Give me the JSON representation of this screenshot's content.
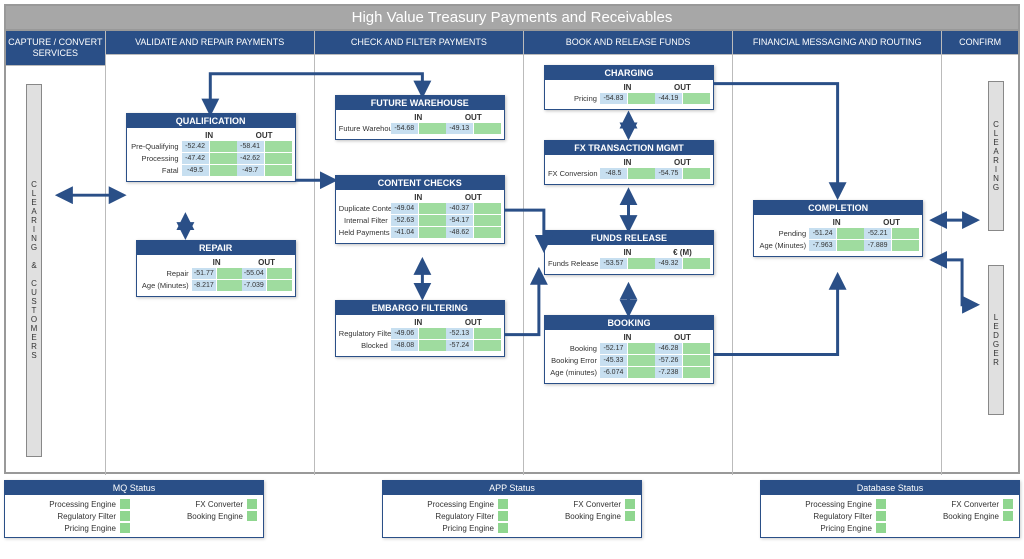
{
  "title": "High Value Treasury Payments and Receivables",
  "lanes": {
    "capture": "CAPTURE / CONVERT SERVICES",
    "validate": "VALIDATE AND REPAIR PAYMENTS",
    "check": "CHECK AND FILTER PAYMENTS",
    "book": "BOOK AND RELEASE FUNDS",
    "messaging": "FINANCIAL MESSAGING AND ROUTING",
    "confirm": "CONFIRM"
  },
  "side": {
    "clearing_customers": "CLEARING & CUSTOMERS",
    "clearing": "CLEARING",
    "ledger": "LEDGER"
  },
  "inout": {
    "in": "IN",
    "out": "OUT"
  },
  "cards": {
    "qualification": {
      "title": "QUALIFICATION",
      "rows": [
        {
          "label": "Pre-Qualifying",
          "in_b": "-52.42",
          "in_g": "",
          "out_b": "-58.41",
          "out_g": ""
        },
        {
          "label": "Processing",
          "in_b": "-47.42",
          "in_g": "",
          "out_b": "-42.62",
          "out_g": ""
        },
        {
          "label": "Fatal",
          "in_b": "-49.5",
          "in_g": "",
          "out_b": "-49.7",
          "out_g": ""
        }
      ]
    },
    "repair": {
      "title": "REPAIR",
      "rows": [
        {
          "label": "Repair",
          "in_b": "-51.77",
          "in_g": "",
          "out_b": "-55.04",
          "out_g": ""
        },
        {
          "label": "Age (Minutes)",
          "in_b": "-8.217",
          "in_g": "",
          "out_b": "-7.039",
          "out_g": ""
        }
      ]
    },
    "future_warehouse": {
      "title": "FUTURE WAREHOUSE",
      "rows": [
        {
          "label": "Future Warehouse",
          "in_b": "-54.68",
          "in_g": "",
          "out_b": "-49.13",
          "out_g": ""
        }
      ]
    },
    "content_checks": {
      "title": "CONTENT CHECKS",
      "rows": [
        {
          "label": "Duplicate Content",
          "in_b": "-49.04",
          "in_g": "",
          "out_b": "-40.37",
          "out_g": ""
        },
        {
          "label": "Internal Filter",
          "in_b": "-52.63",
          "in_g": "",
          "out_b": "-54.17",
          "out_g": ""
        },
        {
          "label": "Held Payments",
          "in_b": "-41.04",
          "in_g": "",
          "out_b": "-48.62",
          "out_g": ""
        }
      ]
    },
    "embargo": {
      "title": "EMBARGO FILTERING",
      "rows": [
        {
          "label": "Regulatory Filter",
          "in_b": "-49.06",
          "in_g": "",
          "out_b": "-52.13",
          "out_g": ""
        },
        {
          "label": "Blocked",
          "in_b": "-48.08",
          "in_g": "",
          "out_b": "-57.24",
          "out_g": ""
        }
      ]
    },
    "charging": {
      "title": "CHARGING",
      "rows": [
        {
          "label": "Pricing",
          "in_b": "-54.83",
          "in_g": "",
          "out_b": "-44.19",
          "out_g": ""
        }
      ]
    },
    "fx": {
      "title": "FX TRANSACTION MGMT",
      "rows": [
        {
          "label": "FX Conversion",
          "in_b": "-48.5",
          "in_g": "",
          "out_b": "-54.75",
          "out_g": ""
        }
      ]
    },
    "funds_release": {
      "title": "FUNDS RELEASE",
      "out_label": "€ (M)",
      "rows": [
        {
          "label": "Funds Release",
          "in_b": "-53.57",
          "in_g": "",
          "out_b": "-49.32",
          "out_g": ""
        }
      ]
    },
    "booking": {
      "title": "BOOKING",
      "rows": [
        {
          "label": "Booking",
          "in_b": "-52.17",
          "in_g": "",
          "out_b": "-46.28",
          "out_g": ""
        },
        {
          "label": "Booking Error",
          "in_b": "-45.33",
          "in_g": "",
          "out_b": "-57.26",
          "out_g": ""
        },
        {
          "label": "Age (minutes)",
          "in_b": "-6.074",
          "in_g": "",
          "out_b": "-7.238",
          "out_g": ""
        }
      ]
    },
    "completion": {
      "title": "COMPLETION",
      "rows": [
        {
          "label": "Pending",
          "in_b": "-51.24",
          "in_g": "",
          "out_b": "-52.21",
          "out_g": ""
        },
        {
          "label": "Age (Minutes)",
          "in_b": "-7.963",
          "in_g": "",
          "out_b": "-7.889",
          "out_g": ""
        }
      ]
    }
  },
  "status": {
    "mq": {
      "title": "MQ Status",
      "items": [
        "Processing Engine",
        "FX Converter",
        "Regulatory Filter",
        "Booking Engine",
        "Pricing Engine"
      ]
    },
    "app": {
      "title": "APP Status",
      "items": [
        "Processing Engine",
        "FX Converter",
        "Regulatory Filter",
        "Booking Engine",
        "Pricing Engine"
      ]
    },
    "db": {
      "title": "Database Status",
      "items": [
        "Processing Engine",
        "FX Converter",
        "Regulatory Filter",
        "Booking Engine",
        "Pricing Engine"
      ]
    }
  },
  "chart_data": {
    "type": "table",
    "title": "High Value Treasury Payments and Receivables — IN/OUT metrics",
    "series": [
      {
        "name": "Qualification/Pre-Qualifying",
        "in": -52.42,
        "out": -58.41
      },
      {
        "name": "Qualification/Processing",
        "in": -47.42,
        "out": -42.62
      },
      {
        "name": "Qualification/Fatal",
        "in": -49.5,
        "out": -49.7
      },
      {
        "name": "Repair/Repair",
        "in": -51.77,
        "out": -55.04
      },
      {
        "name": "Repair/Age (Minutes)",
        "in": -8.217,
        "out": -7.039
      },
      {
        "name": "Future Warehouse",
        "in": -54.68,
        "out": -49.13
      },
      {
        "name": "Content Checks/Duplicate Content",
        "in": -49.04,
        "out": -40.37
      },
      {
        "name": "Content Checks/Internal Filter",
        "in": -52.63,
        "out": -54.17
      },
      {
        "name": "Content Checks/Held Payments",
        "in": -41.04,
        "out": -48.62
      },
      {
        "name": "Embargo/Regulatory Filter",
        "in": -49.06,
        "out": -52.13
      },
      {
        "name": "Embargo/Blocked",
        "in": -48.08,
        "out": -57.24
      },
      {
        "name": "Charging/Pricing",
        "in": -54.83,
        "out": -44.19
      },
      {
        "name": "FX/FX Conversion",
        "in": -48.5,
        "out": -54.75
      },
      {
        "name": "Funds Release",
        "in": -53.57,
        "out": -49.32,
        "out_unit": "EUR M"
      },
      {
        "name": "Booking/Booking",
        "in": -52.17,
        "out": -46.28
      },
      {
        "name": "Booking/Booking Error",
        "in": -45.33,
        "out": -57.26
      },
      {
        "name": "Booking/Age (minutes)",
        "in": -6.074,
        "out": -7.238
      },
      {
        "name": "Completion/Pending",
        "in": -51.24,
        "out": -52.21
      },
      {
        "name": "Completion/Age (Minutes)",
        "in": -7.963,
        "out": -7.889
      }
    ]
  }
}
